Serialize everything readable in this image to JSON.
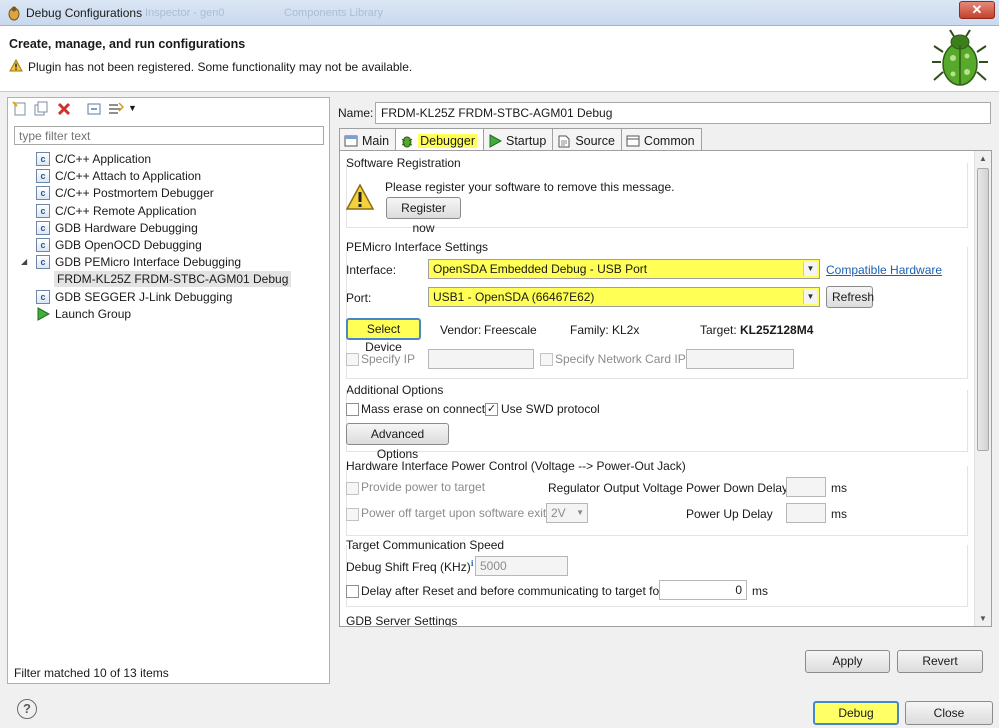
{
  "window": {
    "title": "Debug Configurations",
    "ghost_tabs": [
      "Inspector - gen0",
      "Components Library"
    ]
  },
  "header": {
    "title": "Create, manage, and run configurations",
    "message": "Plugin has not been registered. Some functionality may not be available."
  },
  "left": {
    "filter_placeholder": "type filter text",
    "tree": [
      {
        "label": "C/C++ Application",
        "icon": "c-config-icon"
      },
      {
        "label": "C/C++ Attach to Application",
        "icon": "c-config-icon"
      },
      {
        "label": "C/C++ Postmortem Debugger",
        "icon": "c-config-icon"
      },
      {
        "label": "C/C++ Remote Application",
        "icon": "c-config-icon"
      },
      {
        "label": "GDB Hardware Debugging",
        "icon": "c-config-icon"
      },
      {
        "label": "GDB OpenOCD Debugging",
        "icon": "c-config-icon"
      },
      {
        "label": "GDB PEMicro Interface Debugging",
        "icon": "c-config-icon",
        "expanded": true
      },
      {
        "label": "FRDM-KL25Z FRDM-STBC-AGM01 Debug",
        "icon": "c-config-icon",
        "selected": true
      },
      {
        "label": "GDB SEGGER J-Link Debugging",
        "icon": "c-config-icon"
      },
      {
        "label": "Launch Group",
        "icon": "launch-arrow-icon"
      }
    ],
    "status": "Filter matched 10 of 13 items"
  },
  "right": {
    "name_label": "Name:",
    "name_value": "FRDM-KL25Z FRDM-STBC-AGM01 Debug",
    "tabs": [
      "Main",
      "Debugger",
      "Startup",
      "Source",
      "Common"
    ],
    "active_tab": "Debugger",
    "software_registration": {
      "title": "Software Registration",
      "message": "Please register your software to remove this message.",
      "button": "Register now"
    },
    "pemicro": {
      "title": "PEMicro Interface Settings",
      "interface_label": "Interface:",
      "interface_value": "OpenSDA Embedded Debug - USB Port",
      "compatible_link": "Compatible Hardware",
      "port_label": "Port:",
      "port_value": "USB1 - OpenSDA (66467E62)",
      "refresh": "Refresh",
      "select_device": "Select Device",
      "vendor_label": "Vendor:",
      "vendor_value": "Freescale",
      "family_label": "Family:",
      "family_value": "KL2x",
      "target_label": "Target:",
      "target_value": "KL25Z128M4",
      "specify_ip": "Specify IP",
      "specify_nic": "Specify Network Card IP"
    },
    "additional": {
      "title": "Additional Options",
      "mass_erase": "Mass erase on connect",
      "use_swd": "Use SWD protocol",
      "use_swd_checked": true,
      "advanced": "Advanced Options"
    },
    "power": {
      "title": "Hardware Interface Power Control (Voltage --> Power-Out Jack)",
      "provide_power": "Provide power to target",
      "regulator_label": "Regulator Output Voltage",
      "power_down_label": "Power Down Delay",
      "power_up_label": "Power Up Delay",
      "power_off": "Power off target upon software exit",
      "voltage_value": "2V",
      "ms1": "ms",
      "ms2": "ms"
    },
    "comm": {
      "title": "Target Communication Speed",
      "shift_label": "Debug Shift Freq (KHz)",
      "shift_value": "5000",
      "delay_label": "Delay after Reset and before communicating to target for",
      "delay_value": "0",
      "ms": "ms"
    },
    "gdb_server": {
      "title": "GDB Server Settings"
    },
    "apply": "Apply",
    "revert": "Revert"
  },
  "footer": {
    "help": "?",
    "debug": "Debug",
    "close": "Close"
  }
}
